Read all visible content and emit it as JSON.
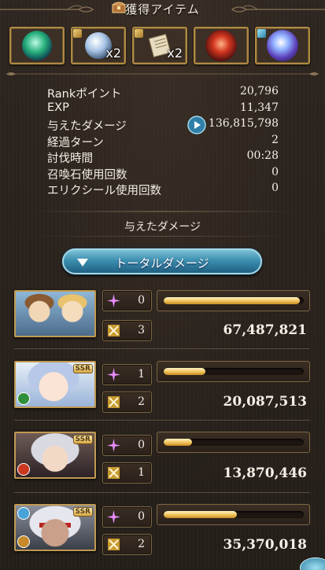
{
  "header": {
    "title": "獲得アイテム"
  },
  "items": [
    {
      "name": "green-orb",
      "count": ""
    },
    {
      "name": "silver-orb",
      "count": "x2"
    },
    {
      "name": "scroll",
      "count": "x2"
    },
    {
      "name": "red-orb",
      "count": ""
    },
    {
      "name": "blue-orb",
      "count": ""
    }
  ],
  "stats": [
    {
      "label": "Rankポイント",
      "value": "20,796"
    },
    {
      "label": "EXP",
      "value": "11,347"
    },
    {
      "label": "与えたダメージ",
      "value": "136,815,798"
    },
    {
      "label": "経過ターン",
      "value": "2"
    },
    {
      "label": "討伐時間",
      "value": "00:28"
    },
    {
      "label": "召喚石使用回数",
      "value": "0"
    },
    {
      "label": "エリクシール使用回数",
      "value": "0"
    }
  ],
  "section": {
    "title": "与えたダメージ"
  },
  "toggle": {
    "label": "トータルダメージ"
  },
  "characters": [
    {
      "ca_count": "0",
      "attack_count": "3",
      "damage": "67,487,821",
      "share": 0.97,
      "ssr": false
    },
    {
      "ca_count": "1",
      "attack_count": "2",
      "damage": "20,087,513",
      "share": 0.3,
      "ssr": true,
      "ssr_label": "SSR"
    },
    {
      "ca_count": "0",
      "attack_count": "1",
      "damage": "13,870,446",
      "share": 0.2,
      "ssr": true,
      "ssr_label": "SSR"
    },
    {
      "ca_count": "0",
      "attack_count": "2",
      "damage": "35,370,018",
      "share": 0.52,
      "ssr": true,
      "ssr_label": "SSR"
    }
  ],
  "colors": {
    "accent": "#3d8fb0",
    "bar": "#f0c35a",
    "frame": "#b08a43"
  }
}
